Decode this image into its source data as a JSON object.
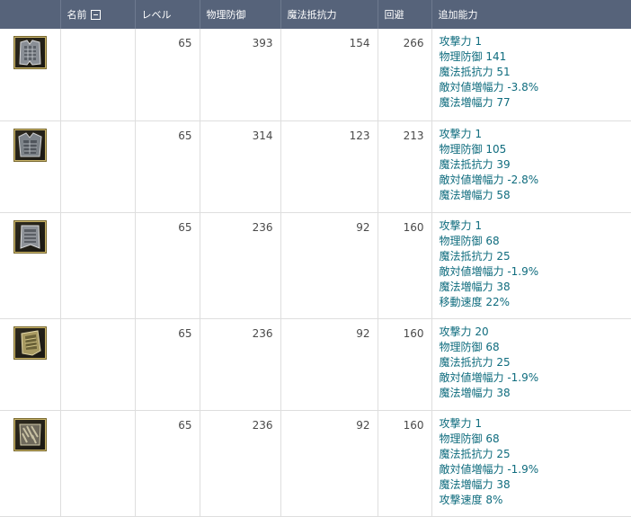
{
  "headers": {
    "icon": "",
    "name": "名前",
    "level": "レベル",
    "phys_def": "物理防御",
    "mag_res": "魔法抵抗力",
    "evasion": "回避",
    "extra": "追加能力"
  },
  "items": [
    {
      "icon": "armor-icon-1",
      "name": "",
      "level": "65",
      "phys_def": "393",
      "mag_res": "154",
      "evasion": "266",
      "extra": [
        "攻撃力 1",
        "物理防御 141",
        "魔法抵抗力 51",
        "敵対値増幅力 -3.8%",
        "魔法増幅力 77"
      ]
    },
    {
      "icon": "armor-icon-2",
      "name": "",
      "level": "65",
      "phys_def": "314",
      "mag_res": "123",
      "evasion": "213",
      "extra": [
        "攻撃力 1",
        "物理防御 105",
        "魔法抵抗力 39",
        "敵対値増幅力 -2.8%",
        "魔法増幅力 58"
      ]
    },
    {
      "icon": "armor-icon-3",
      "name": "",
      "level": "65",
      "phys_def": "236",
      "mag_res": "92",
      "evasion": "160",
      "extra": [
        "攻撃力 1",
        "物理防御 68",
        "魔法抵抗力 25",
        "敵対値増幅力 -1.9%",
        "魔法増幅力 38",
        "移動速度 22%"
      ]
    },
    {
      "icon": "armor-icon-4",
      "name": "",
      "level": "65",
      "phys_def": "236",
      "mag_res": "92",
      "evasion": "160",
      "extra": [
        "攻撃力 20",
        "物理防御 68",
        "魔法抵抗力 25",
        "敵対値増幅力 -1.9%",
        "魔法増幅力 38"
      ]
    },
    {
      "icon": "armor-icon-5",
      "name": "",
      "level": "65",
      "phys_def": "236",
      "mag_res": "92",
      "evasion": "160",
      "extra": [
        "攻撃力 1",
        "物理防御 68",
        "魔法抵抗力 25",
        "敵対値増幅力 -1.9%",
        "魔法増幅力 38",
        "攻撃速度 8%"
      ]
    }
  ]
}
